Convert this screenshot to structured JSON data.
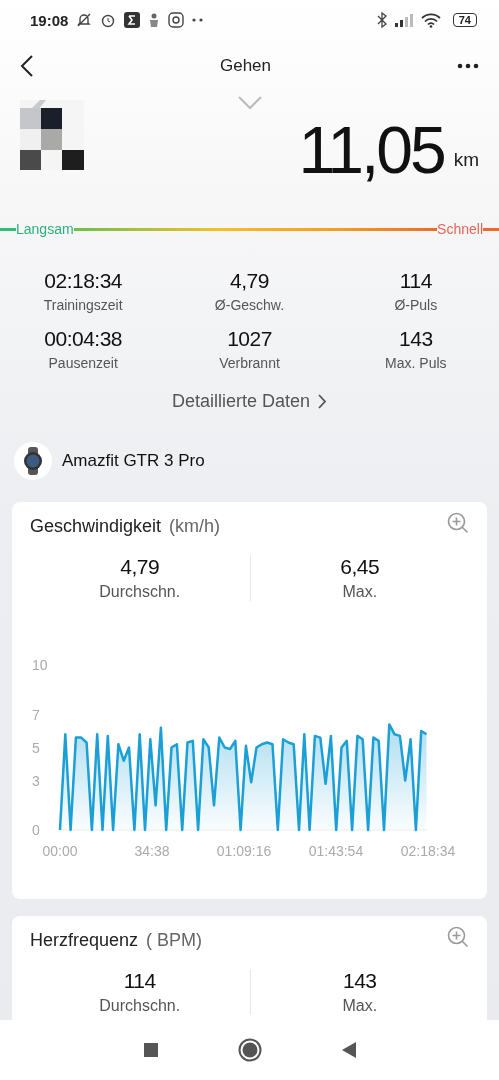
{
  "status_bar": {
    "time": "19:08",
    "battery": "74"
  },
  "header": {
    "title": "Gehen"
  },
  "summary": {
    "distance": "11,05",
    "unit": "km",
    "pace_scale": {
      "slow": "Langsam",
      "fast": "Schnell"
    }
  },
  "stats": [
    {
      "value": "02:18:34",
      "label": "Trainingszeit"
    },
    {
      "value": "4,79",
      "label": "Ø-Geschw."
    },
    {
      "value": "114",
      "label": "Ø-Puls"
    },
    {
      "value": "00:04:38",
      "label": "Pausenzeit"
    },
    {
      "value": "1027",
      "label": "Verbrannt"
    },
    {
      "value": "143",
      "label": "Max. Puls"
    }
  ],
  "details_link": "Detaillierte Daten",
  "device": {
    "name": "Amazfit GTR 3 Pro"
  },
  "cards": [
    {
      "title": "Geschwindigkeit",
      "unit": "(km/h)",
      "stats": [
        {
          "value": "4,79",
          "label": "Durchschn."
        },
        {
          "value": "6,45",
          "label": "Max."
        }
      ],
      "chart_data": {
        "type": "area",
        "x": [
          0,
          2,
          4,
          6,
          8,
          10,
          12,
          14,
          16,
          18,
          20,
          22,
          24,
          26,
          28,
          30,
          32,
          34,
          36,
          38,
          40,
          42,
          44,
          46,
          48,
          50,
          52,
          54,
          56,
          58,
          60,
          62,
          64,
          66,
          68,
          70,
          72,
          74,
          76,
          78,
          80,
          82,
          84,
          86,
          88,
          90,
          92,
          94,
          96,
          98,
          100,
          102,
          104,
          106,
          108,
          110,
          112,
          114,
          116,
          118,
          120,
          122,
          124,
          126,
          128,
          130,
          132,
          134,
          136,
          138
        ],
        "series": [
          {
            "color": "#1a9fd6",
            "values": [
              0,
              5.8,
              0,
              5.6,
              5.6,
              5.3,
              0,
              5.8,
              0,
              5.7,
              0,
              5.2,
              4.2,
              5.0,
              0,
              5.8,
              0,
              5.5,
              1.5,
              6.2,
              0,
              5.0,
              5.2,
              0,
              5.3,
              5.4,
              0,
              5.5,
              5.0,
              1.5,
              5.6,
              5.0,
              4.9,
              5.4,
              0,
              5.1,
              2.9,
              5.0,
              5.2,
              5.3,
              5.2,
              0,
              5.5,
              5.3,
              5.2,
              0,
              5.8,
              0,
              5.7,
              5.6,
              2.8,
              5.7,
              0,
              5.0,
              5.4,
              0,
              5.7,
              5.5,
              0,
              5.6,
              5.4,
              0,
              6.4,
              5.8,
              5.7,
              3.0,
              5.5,
              0,
              6.0,
              5.8
            ]
          }
        ],
        "xlim": [
          0,
          138.57
        ],
        "ylim": [
          0,
          10
        ],
        "yticks": [
          0,
          3,
          5,
          7,
          10
        ],
        "xticks": [
          {
            "value": 0,
            "label": "00:00"
          },
          {
            "value": 34.63,
            "label": "34:38"
          },
          {
            "value": 69.27,
            "label": "01:09:16"
          },
          {
            "value": 103.9,
            "label": "01:43:54"
          },
          {
            "value": 138.57,
            "label": "02:18:34"
          }
        ]
      }
    },
    {
      "title": "Herzfrequenz",
      "unit": "( BPM)",
      "stats": [
        {
          "value": "114",
          "label": "Durchschn."
        },
        {
          "value": "143",
          "label": "Max."
        }
      ]
    }
  ]
}
